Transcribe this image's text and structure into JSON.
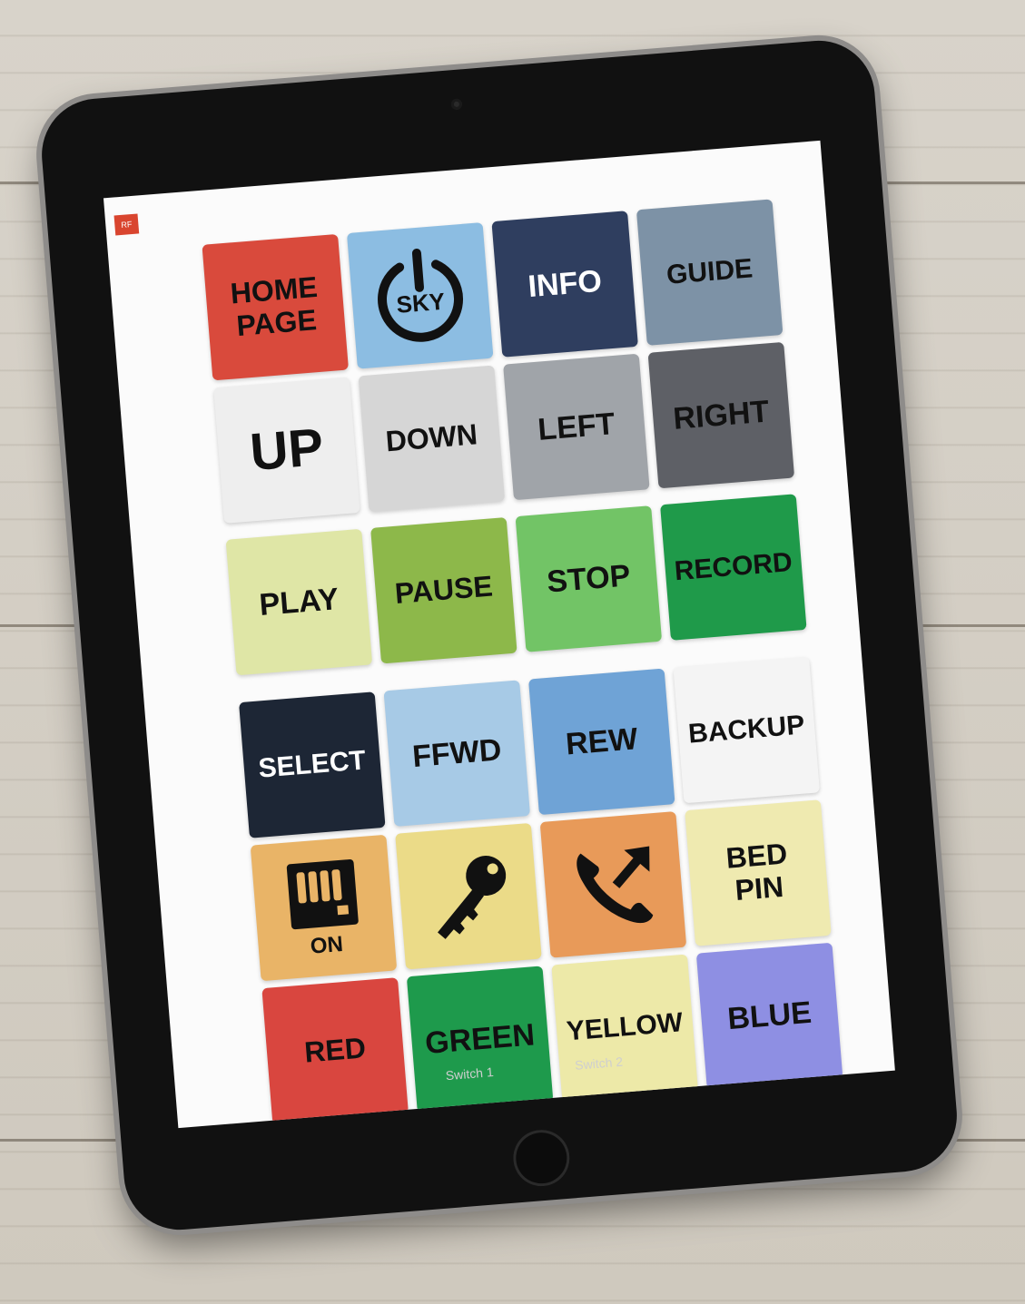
{
  "rf_badge": "RF",
  "tiles": [
    [
      {
        "label": "HOME\nPAGE",
        "bg": "#d94a3c",
        "icon": null
      },
      {
        "label": "SKY",
        "bg": "#8cbde2",
        "icon": "power-icon"
      },
      {
        "label": "INFO",
        "bg": "#2f3e5f",
        "icon": null,
        "text_color": "#ffffff"
      },
      {
        "label": "GUIDE",
        "bg": "#7d92a6",
        "icon": null
      }
    ],
    [
      {
        "label": "UP",
        "bg": "#eeeeee",
        "icon": null
      },
      {
        "label": "DOWN",
        "bg": "#d6d6d6",
        "icon": null
      },
      {
        "label": "LEFT",
        "bg": "#a0a4a9",
        "icon": null
      },
      {
        "label": "RIGHT",
        "bg": "#5e6066",
        "icon": null
      }
    ],
    [
      {
        "label": "PLAY",
        "bg": "#dfe6a6",
        "icon": null
      },
      {
        "label": "PAUSE",
        "bg": "#8db84a",
        "icon": null
      },
      {
        "label": "STOP",
        "bg": "#72c466",
        "icon": null
      },
      {
        "label": "RECORD",
        "bg": "#1f9a4a",
        "icon": null
      }
    ],
    [
      {
        "label": "SELECT",
        "bg": "#1d2635",
        "icon": null,
        "text_color": "#ffffff"
      },
      {
        "label": "FFWD",
        "bg": "#a7cae6",
        "icon": null
      },
      {
        "label": "REW",
        "bg": "#6fa3d6",
        "icon": null
      },
      {
        "label": "BACKUP",
        "bg": "#f4f4f4",
        "icon": null
      }
    ],
    [
      {
        "label": "ON",
        "bg": "#e9b467",
        "icon": "heater-icon"
      },
      {
        "label": "",
        "bg": "#ebdb88",
        "icon": "key-icon"
      },
      {
        "label": "",
        "bg": "#e89a59",
        "icon": "phone-outgoing-icon"
      },
      {
        "label": "BED\nPIN",
        "bg": "#efeab0",
        "icon": null
      }
    ],
    [
      {
        "label": "RED",
        "bg": "#d9463f",
        "icon": null
      },
      {
        "label": "GREEN",
        "bg": "#1e9a4c",
        "icon": null
      },
      {
        "label": "YELLOW",
        "bg": "#ede9a8",
        "icon": null
      },
      {
        "label": "BLUE",
        "bg": "#8e8fe3",
        "icon": null
      }
    ]
  ],
  "switch_labels": [
    "Switch 1",
    "Switch 2"
  ]
}
